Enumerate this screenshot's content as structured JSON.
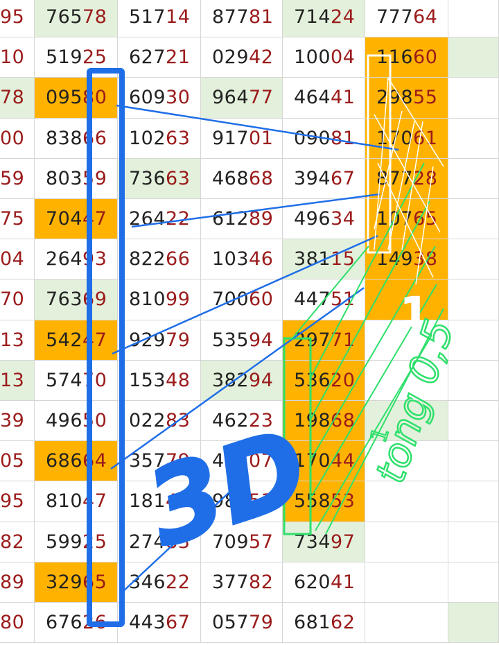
{
  "table": {
    "rows": [
      [
        "95",
        "76578",
        "51714",
        "87781",
        "71424",
        "77764",
        ""
      ],
      [
        "10",
        "51925",
        "62721",
        "02942",
        "10004",
        "11660",
        ""
      ],
      [
        "78",
        "09580",
        "60930",
        "96477",
        "46441",
        "29855",
        ""
      ],
      [
        "00",
        "83866",
        "10263",
        "91701",
        "09081",
        "17061",
        ""
      ],
      [
        "59",
        "80359",
        "73663",
        "46868",
        "39467",
        "87728",
        ""
      ],
      [
        "75",
        "70447",
        "26422",
        "61289",
        "49634",
        "10765",
        ""
      ],
      [
        "04",
        "26493",
        "82266",
        "10346",
        "38115",
        "14938",
        ""
      ],
      [
        "70",
        "76369",
        "81099",
        "70060",
        "44751",
        "",
        ""
      ],
      [
        "13",
        "54247",
        "92979",
        "53594",
        "29771",
        "",
        ""
      ],
      [
        "13",
        "57470",
        "15348",
        "38294",
        "53620",
        "",
        ""
      ],
      [
        "39",
        "49650",
        "02283",
        "46223",
        "19868",
        "",
        ""
      ],
      [
        "05",
        "68664",
        "35779",
        "41507",
        "17044",
        "",
        ""
      ],
      [
        "95",
        "81047",
        "18140",
        "98653",
        "55853",
        "",
        ""
      ],
      [
        "82",
        "59925",
        "27483",
        "70957",
        "73497",
        "",
        ""
      ],
      [
        "89",
        "32965",
        "34622",
        "37782",
        "62041",
        "",
        ""
      ],
      [
        "80",
        "67626",
        "44367",
        "05779",
        "68162",
        "",
        ""
      ]
    ],
    "fills": [
      [
        "",
        "green",
        "",
        "",
        "green",
        "",
        ""
      ],
      [
        "",
        "",
        "",
        "",
        "",
        "orange",
        "green"
      ],
      [
        "green",
        "orange",
        "",
        "green",
        "",
        "orange",
        ""
      ],
      [
        "",
        "",
        "",
        "",
        "",
        "orange",
        ""
      ],
      [
        "",
        "",
        "green",
        "",
        "",
        "orange",
        ""
      ],
      [
        "",
        "orange",
        "",
        "",
        "",
        "orange",
        ""
      ],
      [
        "",
        "",
        "",
        "",
        "green",
        "orange",
        ""
      ],
      [
        "",
        "green",
        "",
        "",
        "",
        "orange",
        ""
      ],
      [
        "",
        "orange",
        "",
        "",
        "orange",
        "",
        ""
      ],
      [
        "green",
        "",
        "",
        "green",
        "orange",
        "",
        ""
      ],
      [
        "",
        "",
        "",
        "",
        "orange",
        "green",
        ""
      ],
      [
        "",
        "orange",
        "",
        "",
        "orange",
        "",
        ""
      ],
      [
        "",
        "",
        "",
        "",
        "orange",
        "",
        ""
      ],
      [
        "",
        "",
        "",
        "",
        "green",
        "",
        ""
      ],
      [
        "",
        "orange",
        "",
        "",
        "",
        "",
        ""
      ],
      [
        "",
        "",
        "",
        "",
        "",
        "",
        "green"
      ]
    ]
  },
  "annotations": {
    "label_3d": "3D",
    "label_1": "1",
    "label_tong": "tong 0,5",
    "label_tong_sup": "1"
  },
  "colors": {
    "orange": "#ffb300",
    "green_fill": "#e3f1dc",
    "digit_dark": "#222222",
    "digit_red": "#9b1b1b",
    "blue_mark": "#1f6ee8",
    "green_mark": "#2ee06b",
    "white_mark": "#ffffff"
  }
}
